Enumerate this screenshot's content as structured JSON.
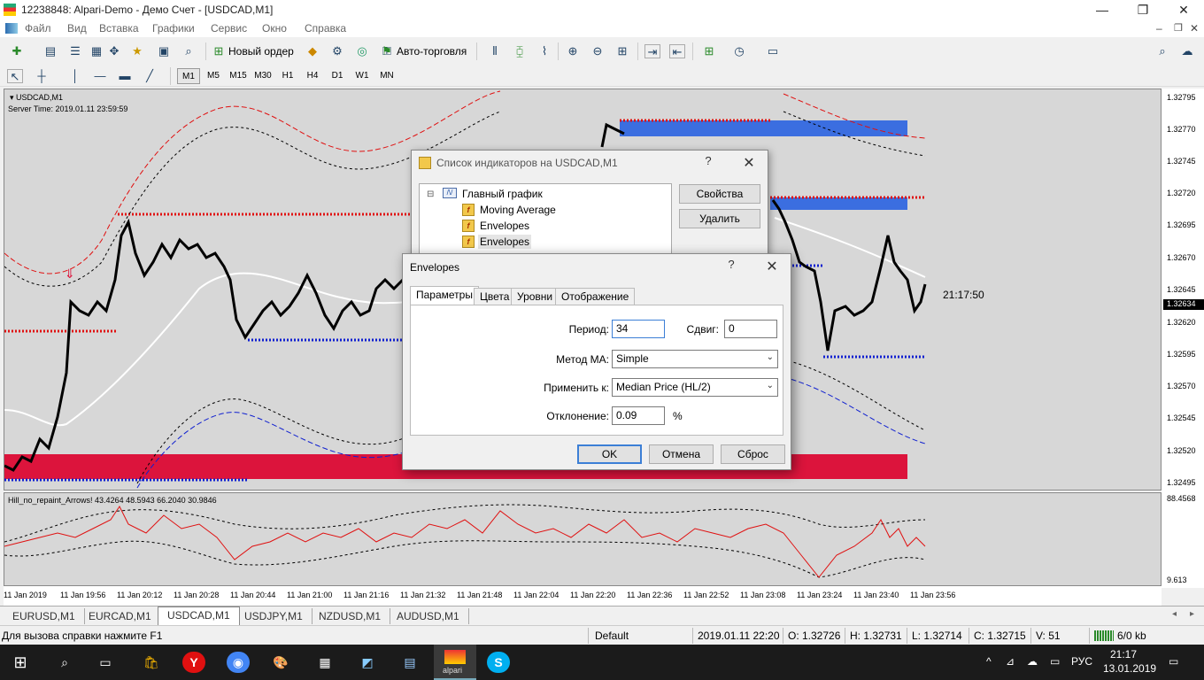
{
  "window": {
    "title": "12238848: Alpari-Demo - Демо Счет - [USDCAD,M1]",
    "controls": [
      "—",
      "❐",
      "✕"
    ]
  },
  "menu": [
    "Файл",
    "Вид",
    "Вставка",
    "Графики",
    "Сервис",
    "Окно",
    "Справка"
  ],
  "toolbar": {
    "new_order": "Новый ордер",
    "auto_trading": "Авто-торговля"
  },
  "timeframes": [
    "M1",
    "M5",
    "M15",
    "M30",
    "H1",
    "H4",
    "D1",
    "W1",
    "MN"
  ],
  "active_timeframe": "M1",
  "chart": {
    "symbol": "USDCAD,M1",
    "server_time": "Server Time: 2019.01.11 23:59:59",
    "clock": "21:17:50",
    "current_price": "1.32634",
    "indicator_label": "Hill_no_repaint_Arrows! 43.4264 48.5943 66.2040 30.9846",
    "indicator_max": "88.4568",
    "indicator_min": "9.613",
    "price_levels": [
      "1.32795",
      "1.32770",
      "1.32745",
      "1.32720",
      "1.32695",
      "1.32670",
      "1.32645",
      "1.32620",
      "1.32595",
      "1.32570",
      "1.32545",
      "1.32520",
      "1.32495"
    ],
    "time_labels": [
      "11 Jan 2019",
      "11 Jan 19:56",
      "11 Jan 20:12",
      "11 Jan 20:28",
      "11 Jan 20:44",
      "11 Jan 21:00",
      "11 Jan 21:16",
      "11 Jan 21:32",
      "11 Jan 21:48",
      "11 Jan 22:04",
      "11 Jan 22:20",
      "11 Jan 22:36",
      "11 Jan 22:52",
      "11 Jan 23:08",
      "11 Jan 23:24",
      "11 Jan 23:40",
      "11 Jan 23:56"
    ]
  },
  "chart_tabs": [
    "EURUSD,M1",
    "EURCAD,M1",
    "USDCAD,M1",
    "USDJPY,M1",
    "NZDUSD,M1",
    "AUDUSD,M1"
  ],
  "active_chart_tab": "USDCAD,M1",
  "status": {
    "help": "Для вызова справки нажмите F1",
    "profile": "Default",
    "datetime": "2019.01.11 22:20",
    "open": "O: 1.32726",
    "high": "H: 1.32731",
    "low": "L: 1.32714",
    "close": "C: 1.32715",
    "volume": "V: 51",
    "traffic": "6/0 kb"
  },
  "indicator_list_dialog": {
    "title": "Список индикаторов на USDCAD,M1",
    "help": "?",
    "close": "✕",
    "tree_root": "Главный график",
    "items": [
      "Moving Average",
      "Envelopes",
      "Envelopes"
    ],
    "properties_button": "Свойства",
    "delete_button": "Удалить"
  },
  "envelopes_dialog": {
    "title": "Envelopes",
    "help": "?",
    "close": "✕",
    "tabs": [
      "Параметры",
      "Цвета",
      "Уровни",
      "Отображение"
    ],
    "active_tab": "Параметры",
    "period_label": "Период:",
    "period_value": "34",
    "shift_label": "Сдвиг:",
    "shift_value": "0",
    "ma_method_label": "Метод МА:",
    "ma_method_value": "Simple",
    "apply_to_label": "Применить к:",
    "apply_to_value": "Median Price (HL/2)",
    "deviation_label": "Отклонение:",
    "deviation_value": "0.09",
    "deviation_unit": "%",
    "ok_button": "OK",
    "cancel_button": "Отмена",
    "reset_button": "Сброс"
  },
  "taskbar": {
    "language": "РУС",
    "time": "21:17",
    "date": "13.01.2019",
    "alpari_label": "alpari"
  }
}
